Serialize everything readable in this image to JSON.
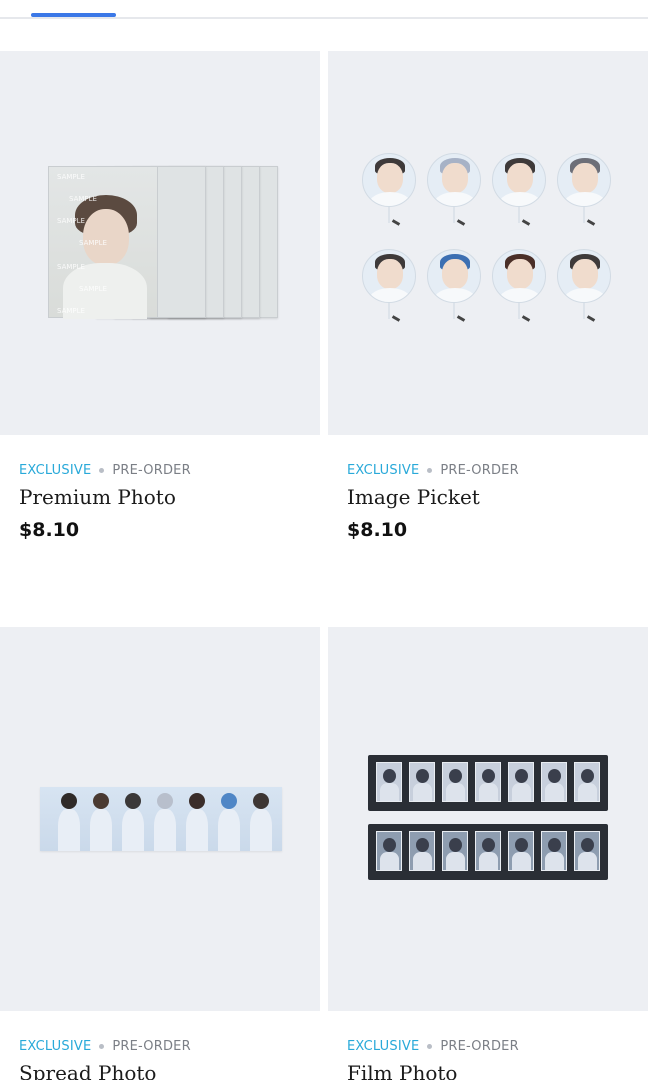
{
  "tabs": {
    "active_index": 0
  },
  "products": [
    {
      "tag_primary": "EXCLUSIVE",
      "tag_secondary": "PRE-ORDER",
      "title": "Premium Photo",
      "price": "$8.10",
      "image_icon": "premium-photo-image",
      "watermark": "SAMPLE"
    },
    {
      "tag_primary": "EXCLUSIVE",
      "tag_secondary": "PRE-ORDER",
      "title": "Image Picket",
      "price": "$8.10",
      "image_icon": "image-picket-image"
    },
    {
      "tag_primary": "EXCLUSIVE",
      "tag_secondary": "PRE-ORDER",
      "title": "Spread Photo",
      "image_icon": "spread-photo-image"
    },
    {
      "tag_primary": "EXCLUSIVE",
      "tag_secondary": "PRE-ORDER",
      "title": "Film Photo",
      "image_icon": "film-photo-image"
    }
  ],
  "colors": {
    "accent": "#3b78e7",
    "tag_exclusive": "#29a9d9",
    "tag_secondary": "#7b7f86",
    "thumb_bg": "#edeff3",
    "divider": "#e6e8ec"
  }
}
